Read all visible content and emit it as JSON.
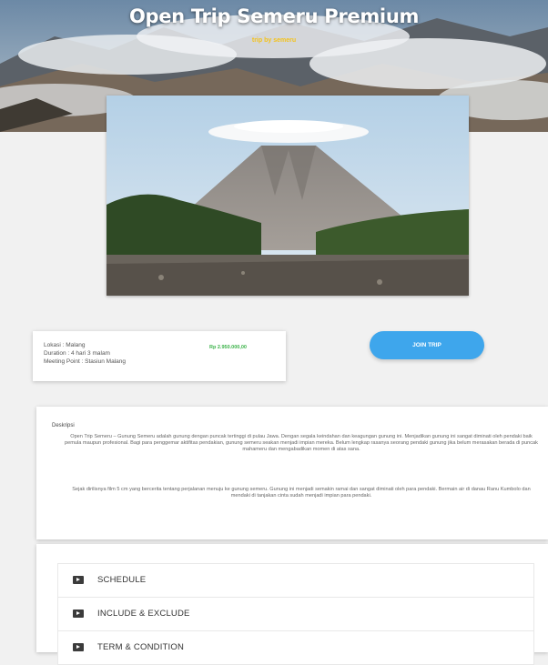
{
  "hero": {
    "title": "Open Trip Semeru Premium",
    "subtitle": "trip by semeru"
  },
  "trip_info": {
    "location": "Lokasi : Malang",
    "duration": "Duration : 4 hari 3 malam",
    "meeting_point": "Meeting Point : Stasiun Malang",
    "price": "Rp 2.950.000,00"
  },
  "actions": {
    "join_label": "JOIN TRIP"
  },
  "description": {
    "title": "Deskripsi",
    "paragraph_1": "Open Trip Semeru – Gunung Semeru adalah gunung dengan puncak tertinggi di pulau Jawa. Dengan segala keindahan dan keagungan gunung ini. Menjadikan gunung ini sangat diminati oleh pendaki baik pemula maupun profesional. Bagi para penggemar aktifitas pendakian, gunung semeru seakan menjadi impian mereka. Belum lengkap rasanya seorang pendaki gunung jika belum merasakan berada di puncak mahameru dan mengabadikan momen di atas sana.",
    "paragraph_2": "Sejak dirilisnya film 5 cm yang bercerita tentang perjalanan menuju ke gunung semeru. Gunung ini menjadi semakin ramai dan sangat diminati oleh para pendaki. Bermain air di danau Ranu Kumbolo dan mendaki di tanjakan cinta sudah menjadi impian para pendaki."
  },
  "accordion": [
    {
      "label": "SCHEDULE",
      "icon": "caret-right-icon"
    },
    {
      "label": "INCLUDE & EXCLUDE",
      "icon": "caret-right-icon"
    },
    {
      "label": "TERM & CONDITION",
      "icon": "caret-right-icon"
    }
  ],
  "colors": {
    "accent": "#3ea6ec",
    "price": "#3cb34a",
    "subtitle": "#f4c21a"
  }
}
